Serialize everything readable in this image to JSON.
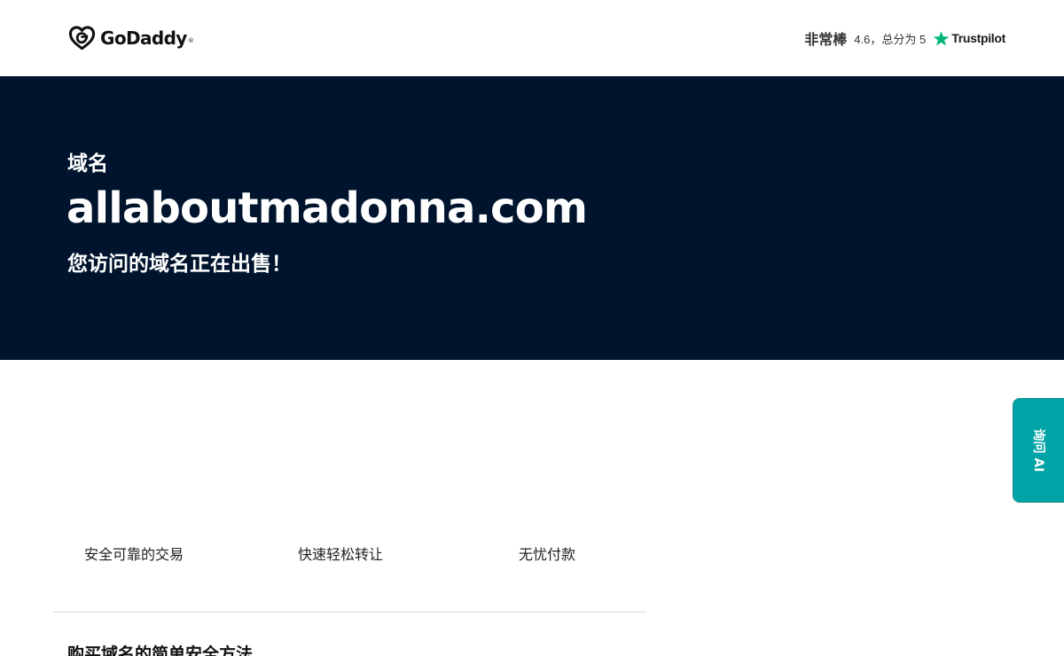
{
  "header": {
    "brand": "GoDaddy",
    "brand_mark": "®",
    "logo_icon": "godaddy-heart-logo-icon",
    "rating": {
      "word": "非常棒",
      "score_text": "4.6，总分为 5",
      "star_icon": "trustpilot-star-icon",
      "provider": "Trustpilot",
      "star_color": "#00b67a"
    }
  },
  "hero": {
    "label": "域名",
    "domain": "allaboutmadonna.com",
    "subtitle": "您访问的域名正在出售！",
    "background": "#00142d"
  },
  "features": [
    {
      "label": "安全可靠的交易"
    },
    {
      "label": "快速轻松转让"
    },
    {
      "label": "无忧付款"
    }
  ],
  "section": {
    "title": "购买域名的简单安全方法"
  },
  "ai_tab": {
    "label": "询问 AI",
    "color": "#00a4a6"
  }
}
